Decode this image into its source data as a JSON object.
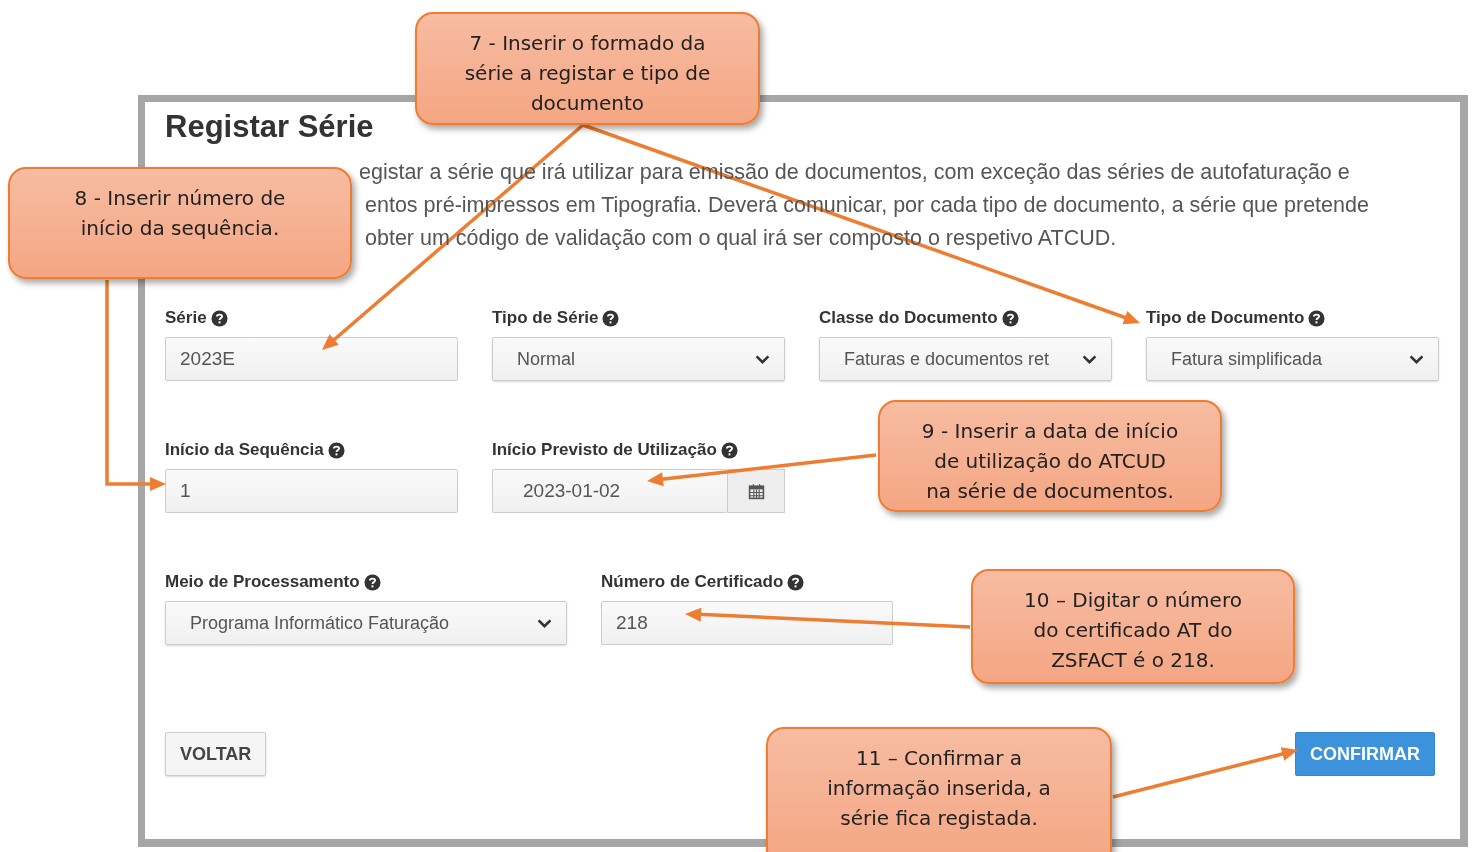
{
  "form": {
    "title": "Registar Série",
    "intro_lines": [
      "egistar a série que irá utilizar para emissão de documentos, com exceção das séries de autofaturação e",
      "entos pré-impressos em Tipografia. Deverá comunicar, por cada tipo de documento, a série que pretende",
      "obter um código de validação com o qual irá ser composto o respetivo ATCUD."
    ],
    "rows": [
      [
        {
          "kind": "text",
          "label": "Série",
          "value": "2023E"
        },
        {
          "kind": "select",
          "label": "Tipo de Série",
          "value": "Normal"
        },
        {
          "kind": "select",
          "label": "Classe do Documento",
          "value": "Faturas e documentos ret"
        },
        {
          "kind": "select",
          "label": "Tipo de Documento",
          "value": "Fatura simplificada"
        }
      ],
      [
        {
          "kind": "text",
          "label": "Início da Sequência",
          "value": "1"
        },
        {
          "kind": "date",
          "label": "Início Previsto de Utilização",
          "value": "2023-01-02"
        }
      ],
      [
        {
          "kind": "select",
          "label": "Meio de Processamento",
          "value": "Programa Informático Faturação"
        },
        {
          "kind": "text",
          "label": "Número de Certificado",
          "value": "218"
        }
      ]
    ],
    "buttons": [
      {
        "kind": "secondary",
        "label": "VOLTAR"
      },
      {
        "kind": "primary",
        "label": "CONFIRMAR"
      }
    ]
  },
  "annotations": [
    {
      "text": "7 - Inserir o formado da\nsérie a registar e tipo de\ndocumento"
    },
    {
      "text": "8 - Inserir número de\ninício da sequência."
    },
    {
      "text": "9 - Inserir a data de início\nde utilização do ATCUD\nna série de documentos."
    },
    {
      "text": "10 – Digitar o número\ndo certificado AT do\nZSFACT é o 218."
    },
    {
      "text": "11 – Confirmar a\ninformação inserida, a\nsérie fica registada."
    }
  ]
}
